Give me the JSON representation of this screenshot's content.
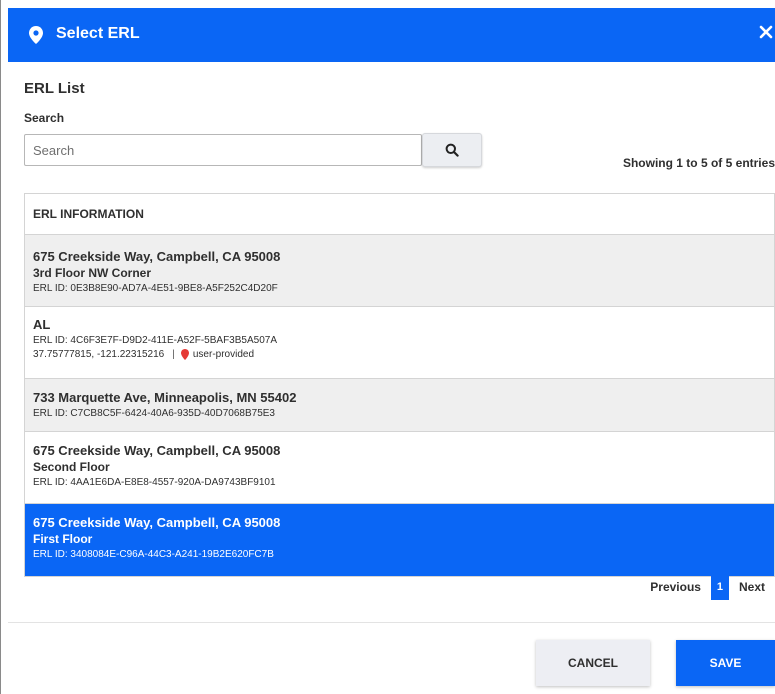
{
  "modal": {
    "title": "Select ERL",
    "pin_icon": "map-pin-icon",
    "close_icon": "close-icon",
    "section_title": "ERL List",
    "search_label": "Search",
    "search_placeholder": "Search",
    "search_value": "",
    "search_button_icon": "search-icon",
    "entries_text": "Showing 1 to 5 of 5 entries",
    "table_header": "ERL INFORMATION",
    "rows": [
      {
        "address": "675 Creekside Way, Campbell, CA 95008",
        "location": "3rd Floor NW Corner",
        "erl_id": "ERL ID: 0E3B8E90-AD7A-4E51-9BE8-A5F252C4D20F",
        "selected": false
      },
      {
        "address": "AL",
        "erl_id": "ERL ID: 4C6F3E7F-D9D2-411E-A52F-5BAF3B5A507A",
        "coords": "37.75777815, -121.22315216",
        "coord_source": "user-provided",
        "selected": false
      },
      {
        "address": "733 Marquette Ave, Minneapolis, MN 55402",
        "erl_id": "ERL ID: C7CB8C5F-6424-40A6-935D-40D7068B75E3",
        "selected": false
      },
      {
        "address": "675 Creekside Way, Campbell, CA 95008",
        "location": "Second Floor",
        "erl_id": "ERL ID: 4AA1E6DA-E8E8-4557-920A-DA9743BF9101",
        "selected": false
      },
      {
        "address": "675 Creekside Way, Campbell, CA 95008",
        "location": "First Floor",
        "erl_id": "ERL ID: 3408084E-C96A-44C3-A241-19B2E620FC7B",
        "selected": true
      }
    ],
    "pagination": {
      "previous": "Previous",
      "current": "1",
      "next": "Next"
    },
    "cancel_label": "CANCEL",
    "save_label": "SAVE"
  },
  "colors": {
    "primary": "#0a66f5",
    "row_alt": "#efefef",
    "pin_red": "#e53935"
  }
}
